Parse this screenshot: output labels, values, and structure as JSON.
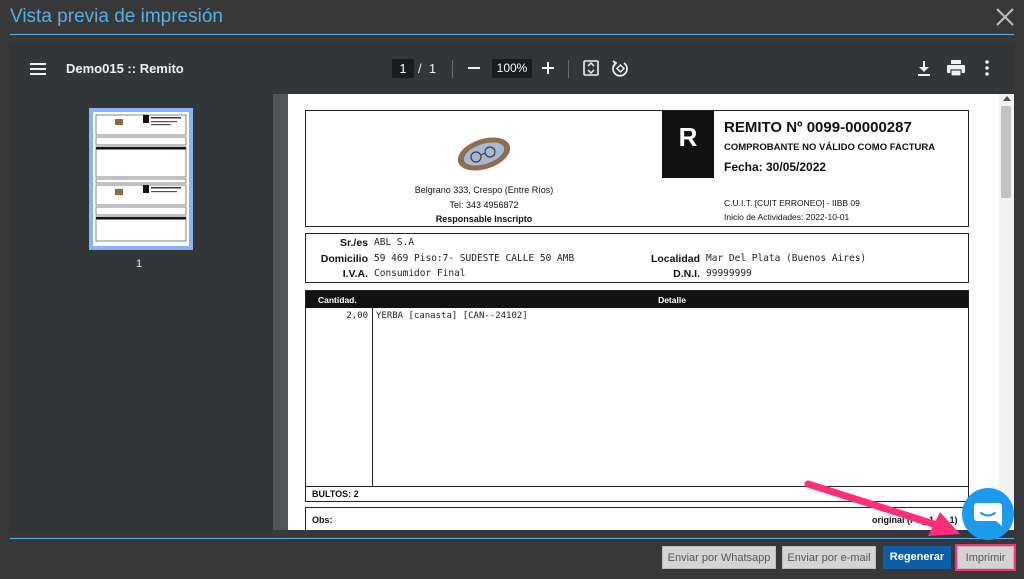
{
  "dialog": {
    "title": "Vista previa de impresión"
  },
  "toolbar": {
    "doc_title": "Demo015 :: Remito",
    "current_page": "1",
    "page_sep": "/",
    "total_pages": "1",
    "zoom": "100%",
    "icons": [
      "menu-icon",
      "zoom-out-icon",
      "zoom-in-icon",
      "fit-page-icon",
      "rotate-icon",
      "download-icon",
      "print-icon",
      "more-vert-icon"
    ]
  },
  "thumbnails": [
    {
      "page": "1"
    }
  ],
  "document": {
    "company": {
      "address": "Belgrano 333, Crespo (Entre Ríos)",
      "tel": "Tel: 343 4956872",
      "iva": "Responsable Inscripto"
    },
    "letter": "R",
    "title": "REMITO  Nº 0099-00000287",
    "subtitle": "COMPROBANTE NO VÁLIDO COMO FACTURA",
    "date": "Fecha: 30/05/2022",
    "cuit": "C.U.I.T. [CUIT ERRONEO] - IIBB 09",
    "start": "Inicio de Actividades: 2022-10-01",
    "client": {
      "name_label": "Sr./es",
      "name": "ABL S.A",
      "address_label": "Domicilio",
      "address": "59 469 Piso:7- SUDESTE CALLE 50 AMB",
      "city_label": "Localidad",
      "city": "Mar Del Plata (Buenos Aires)",
      "iva_label": "I.V.A.",
      "iva": "Consumidor Final",
      "dni_label": "D.N.I.",
      "dni": "99999999"
    },
    "items_header": {
      "qty": "Cantidad.",
      "detail": "Detalle"
    },
    "items": [
      {
        "qty": "2,00",
        "detail": "YERBA [canasta] [CAN--24102]"
      }
    ],
    "bultos": "BULTOS: 2",
    "obs_label": "Obs:",
    "page_count": "original (Pág 1 de 1)"
  },
  "buttons": {
    "whatsapp": "Enviar por Whatsapp",
    "email": "Enviar por e-mail",
    "regen": "Regenerar",
    "print": "Imprimir"
  },
  "colors": {
    "accent": "#5aaee6",
    "primary_button": "#0f5fa8",
    "highlight": "#ff2d7a",
    "chat": "#1b9aee"
  }
}
